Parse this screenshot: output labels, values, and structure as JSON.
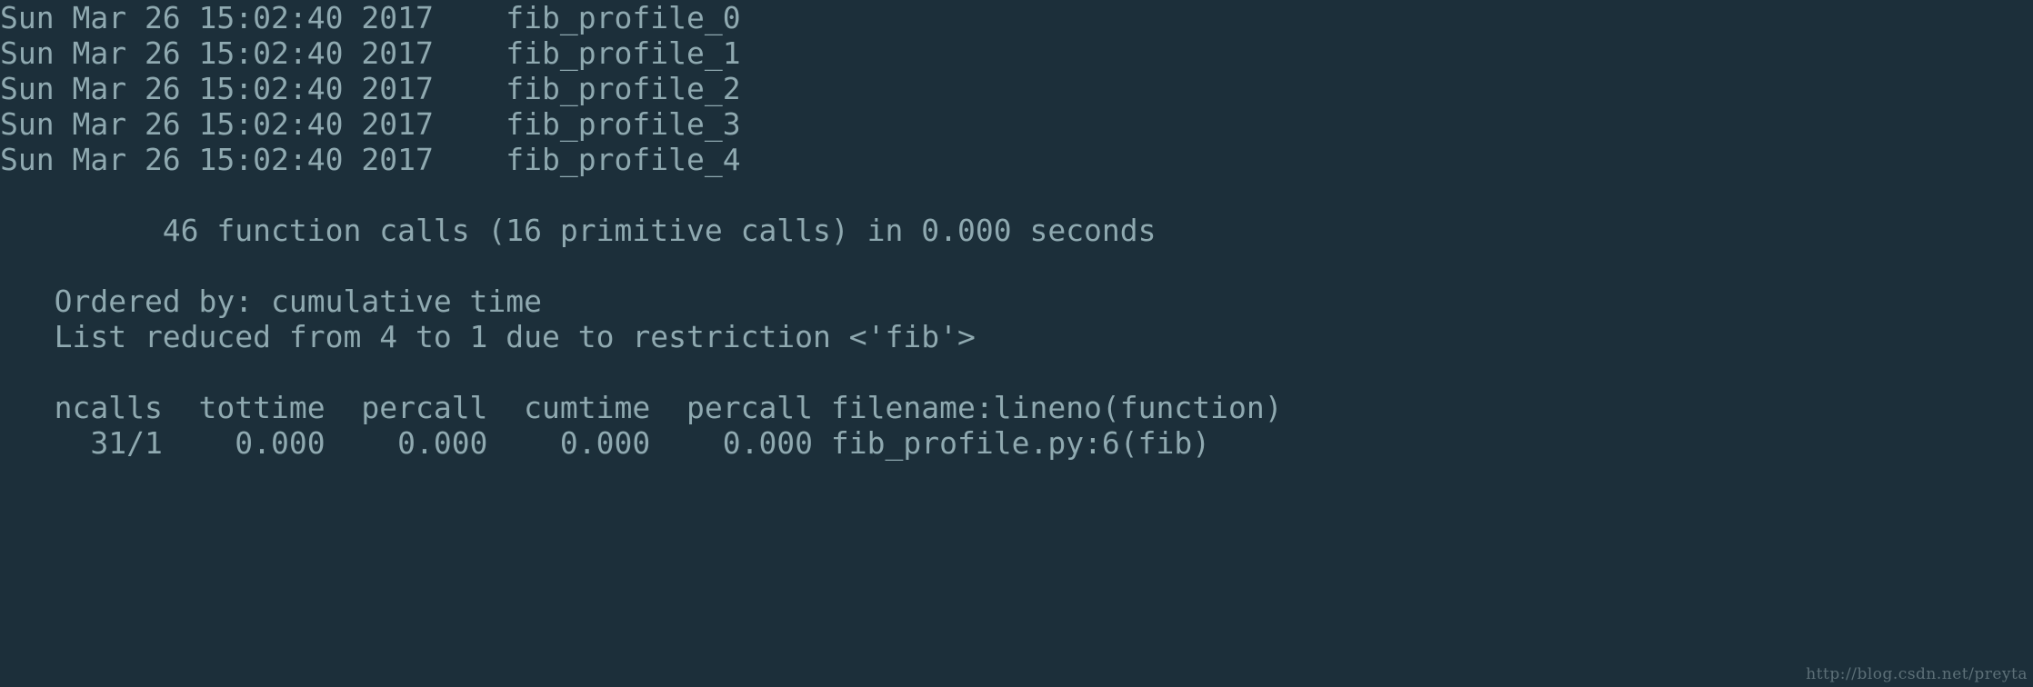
{
  "terminal": {
    "background_color": "#1c2f3a",
    "text_color": "#8fa9b0",
    "lines": [
      "Sun Mar 26 15:02:40 2017    fib_profile_0",
      "Sun Mar 26 15:02:40 2017    fib_profile_1",
      "Sun Mar 26 15:02:40 2017    fib_profile_2",
      "Sun Mar 26 15:02:40 2017    fib_profile_3",
      "Sun Mar 26 15:02:40 2017    fib_profile_4",
      "",
      "         46 function calls (16 primitive calls) in 0.000 seconds",
      "",
      "   Ordered by: cumulative time",
      "   List reduced from 4 to 1 due to restriction <'fib'>",
      "",
      "   ncalls  tottime  percall  cumtime  percall filename:lineno(function)",
      "     31/1    0.000    0.000    0.000    0.000 fib_profile.py:6(fib)"
    ],
    "profile_entries": [
      {
        "timestamp": "Sun Mar 26 15:02:40 2017",
        "name": "fib_profile_0"
      },
      {
        "timestamp": "Sun Mar 26 15:02:40 2017",
        "name": "fib_profile_1"
      },
      {
        "timestamp": "Sun Mar 26 15:02:40 2017",
        "name": "fib_profile_2"
      },
      {
        "timestamp": "Sun Mar 26 15:02:40 2017",
        "name": "fib_profile_3"
      },
      {
        "timestamp": "Sun Mar 26 15:02:40 2017",
        "name": "fib_profile_4"
      }
    ],
    "summary": {
      "function_calls": "46",
      "primitive_calls": "16",
      "seconds": "0.000",
      "text": "46 function calls (16 primitive calls) in 0.000 seconds"
    },
    "ordered_by": "Ordered by: cumulative time",
    "list_reduced": "List reduced from 4 to 1 due to restriction <'fib'>",
    "stats_table": {
      "headers": [
        "ncalls",
        "tottime",
        "percall",
        "cumtime",
        "percall",
        "filename:lineno(function)"
      ],
      "rows": [
        [
          "31/1",
          "0.000",
          "0.000",
          "0.000",
          "0.000",
          "fib_profile.py:6(fib)"
        ]
      ]
    }
  },
  "watermark": {
    "text": "http://blog.csdn.net/preyta",
    "color": "#5d7078"
  }
}
